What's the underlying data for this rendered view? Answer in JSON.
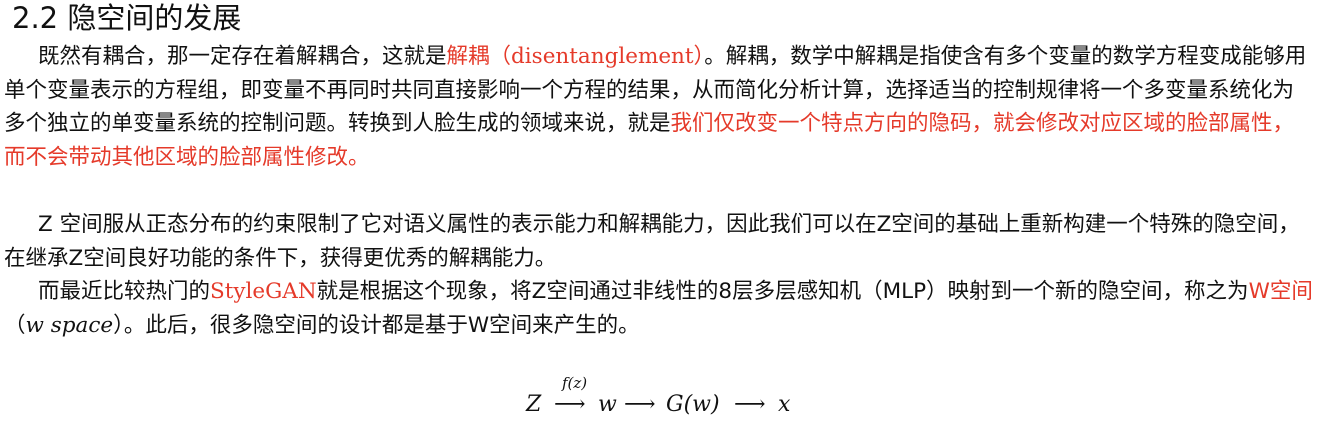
{
  "section_title": "2.2 隐空间的发展",
  "para1": {
    "s1": "既然有耦合，那一定存在着解耦合，这就是",
    "s2_red": "解耦",
    "s3": "（disentanglement）",
    "s4": "。解耦，数学中解耦是指使含有多个变量的数学方程变成能够用单个变量表示的方程组，即变量不再同时共同直接影响一个方程的结果，从而简化分析计算，选择适当的控制规律将一个多变量系统化为多个独立的单变量系统的控制问题。转换到人脸生成的领域来说，就是",
    "s5_red": "我们仅改变一个特点方向的隐码，就会修改对应区域的脸部属性，而不会带动其他区域的脸部属性修改。"
  },
  "para2": {
    "s1": "Z 空间服从正态分布的约束限制了它对语义属性的表示能力和解耦能力，因此我们可以在Z空间的基础上重新构建一个特殊的隐空间，在继承Z空间良好功能的条件下，获得更优秀的解耦能力。"
  },
  "para3": {
    "s1": "而最近比较热门的",
    "s2_red": "StyleGAN",
    "s3": "就是根据这个现象，将Z空间通过非线性的8层多层感知机（MLP）映射到一个新的隐空间，称之为",
    "s4_red": "W空间",
    "s5": "（",
    "s6_italic": "w space",
    "s7": "）。此后，很多隐空间的设计都是基于W空间来产生的。"
  },
  "formula": {
    "z": "Z",
    "arrow_label": "f(z)",
    "arrow1": "⟶",
    "w": "w",
    "arrow2": "⟶",
    "gw": "G(w)",
    "arrow3": "⟶",
    "x": "x"
  }
}
